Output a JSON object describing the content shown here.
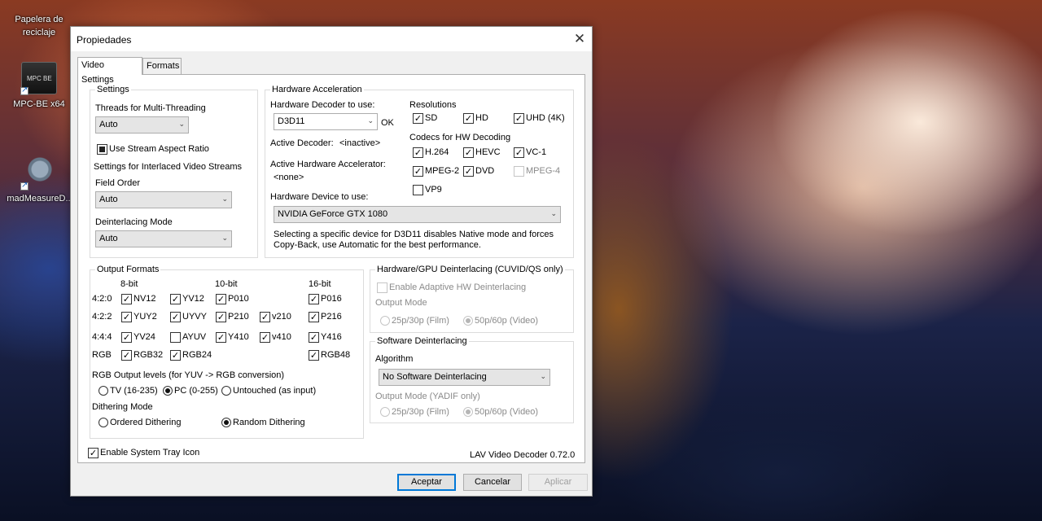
{
  "desktop": {
    "icons": [
      {
        "label": "Papelera de reciclaje",
        "icon": "recycle-bin-icon"
      },
      {
        "label": "MPC-BE x64",
        "icon": "mpc-be-icon"
      },
      {
        "label": "madMeasureD...",
        "icon": "madmeasure-icon"
      }
    ]
  },
  "dialog": {
    "title": "Propiedades",
    "close_glyph": "✕",
    "tabs": [
      "Video Settings",
      "Formats"
    ],
    "settings": {
      "title": "Settings",
      "threads_label": "Threads for Multi-Threading",
      "threads_value": "Auto",
      "stream_aspect": "Use Stream Aspect Ratio",
      "interlaced_label": "Settings for Interlaced Video Streams",
      "field_order_label": "Field Order",
      "field_order_value": "Auto",
      "deint_mode_label": "Deinterlacing Mode",
      "deint_mode_value": "Auto"
    },
    "hwaccel": {
      "title": "Hardware Acceleration",
      "decoder_label": "Hardware Decoder to use:",
      "decoder_value": "D3D11",
      "decoder_status": "OK",
      "active_decoder_label": "Active Decoder:",
      "active_decoder_value": "<inactive>",
      "active_accel_label": "Active Hardware Accelerator:",
      "active_accel_value": "<none>",
      "device_label": "Hardware Device to use:",
      "device_value": "NVIDIA GeForce GTX 1080",
      "note_line1": "Selecting a specific device for D3D11 disables Native mode and forces",
      "note_line2": "Copy-Back, use Automatic for the best performance.",
      "resolutions_label": "Resolutions",
      "res_sd": "SD",
      "res_hd": "HD",
      "res_uhd": "UHD (4K)",
      "codecs_label": "Codecs for HW Decoding",
      "codec_h264": "H.264",
      "codec_hevc": "HEVC",
      "codec_vc1": "VC-1",
      "codec_mpeg2": "MPEG-2",
      "codec_dvd": "DVD",
      "codec_mpeg4": "MPEG-4",
      "codec_vp9": "VP9"
    },
    "output_formats": {
      "title": "Output Formats",
      "col_8bit": "8-bit",
      "col_10bit": "10-bit",
      "col_16bit": "16-bit",
      "row_420": "4:2:0",
      "row_422": "4:2:2",
      "row_444": "4:4:4",
      "row_rgb": "RGB",
      "nv12": "NV12",
      "yv12": "YV12",
      "p010": "P010",
      "p016": "P016",
      "yuy2": "YUY2",
      "uyvy": "UYVY",
      "p210": "P210",
      "v210": "v210",
      "p216": "P216",
      "yv24": "YV24",
      "ayuv": "AYUV",
      "y410": "Y410",
      "v410": "v410",
      "y416": "Y416",
      "rgb32": "RGB32",
      "rgb24": "RGB24",
      "rgb48": "RGB48",
      "rgb_levels_label": "RGB Output levels (for YUV -> RGB conversion)",
      "levels_tv": "TV (16-235)",
      "levels_pc": "PC (0-255)",
      "levels_untouched": "Untouched (as input)",
      "dithering_label": "Dithering Mode",
      "dither_ordered": "Ordered Dithering",
      "dither_random": "Random Dithering"
    },
    "hw_deint": {
      "title": "Hardware/GPU Deinterlacing (CUVID/QS only)",
      "adaptive": "Enable Adaptive HW Deinterlacing",
      "output_mode_label": "Output Mode",
      "film": "25p/30p (Film)",
      "video": "50p/60p (Video)"
    },
    "sw_deint": {
      "title": "Software Deinterlacing",
      "algorithm_label": "Algorithm",
      "algorithm_value": "No Software Deinterlacing",
      "output_mode_label": "Output Mode (YADIF only)",
      "film": "25p/30p (Film)",
      "video": "50p/60p (Video)"
    },
    "tray_icon": "Enable System Tray Icon",
    "version": "LAV Video Decoder 0.72.0",
    "buttons": {
      "ok": "Aceptar",
      "cancel": "Cancelar",
      "apply": "Aplicar"
    }
  }
}
